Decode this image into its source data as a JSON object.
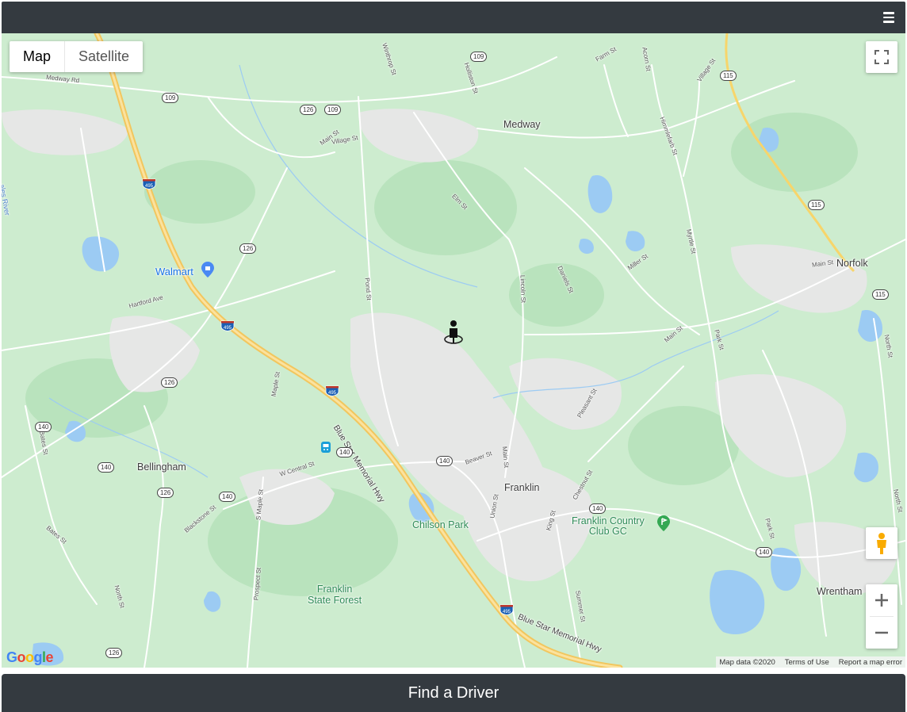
{
  "menu_icon": "hamburger-icon",
  "map": {
    "type_controls": {
      "map": "Map",
      "satellite": "Satellite"
    },
    "towns": {
      "medway": "Medway",
      "norfolk": "Norfolk",
      "bellingham": "Bellingham",
      "franklin": "Franklin",
      "wrentham": "Wrentham"
    },
    "places": {
      "walmart": "Walmart",
      "chilson_park": "Chilson Park",
      "franklin_country_club": "Franklin Country\nClub GC",
      "franklin_state_forest": "Franklin\nState Forest",
      "river": "ales River"
    },
    "streets": {
      "medway_rd": "Medway Rd",
      "winthrop_st": "Winthrop St",
      "holliston_st": "Holliston St",
      "farm_st": "Farm St",
      "acorn_st": "Acorn St",
      "village_st_ne": "Village St",
      "main_st_nw": "Main St",
      "village_st": "Village St",
      "elm_st": "Elm St",
      "himmlefarb_st": "Himmlefarb St",
      "hartford_ave": "Hartford Ave",
      "pond_st": "Pond St",
      "lincoln_st": "Lincoln St",
      "daniels_st": "Daniels St",
      "miller_st": "Miller St",
      "myrtle_st": "Myrtle St",
      "main_st_ne": "Main St",
      "park_st": "Park St",
      "main_st_e": "Main St",
      "north_st_e": "North St",
      "maple_st": "Maple St",
      "blue_star_hwy": "Blue Star Memorial Hwy",
      "blue_star_hwy_2": "Blue Star Memorial Hwy",
      "w_central_st": "W Central St",
      "beaver_st": "Beaver St",
      "main_st_franklin": "Main St",
      "pleasant_st": "Pleasant St",
      "chestnut_st": "Chestnut St",
      "union_st": "Union St",
      "king_st": "King St",
      "bates_st": "Bates St",
      "s_maple_st": "S Maple St",
      "blackstone_st": "Blackstone St",
      "bates_st_2": "Bates St",
      "north_st": "North St",
      "prospect_st": "Prospect St",
      "summer_st": "Summer St",
      "park_st_2": "Park St",
      "north_st_2": "North St"
    },
    "shields": {
      "r109a": "109",
      "r109b": "109",
      "r109c": "109",
      "r126a": "126",
      "r126b": "126",
      "r126c": "126",
      "r126d": "126",
      "r126e": "126",
      "r115a": "115",
      "r115b": "115",
      "r115c": "115",
      "r140a": "140",
      "r140b": "140",
      "r140c": "140",
      "r140d": "140",
      "r140e": "140",
      "r140f": "140",
      "r140g": "140",
      "i495a": "495",
      "i495b": "495",
      "i495c": "495",
      "i495d": "495"
    },
    "controls": {
      "fullscreen_icon": "fullscreen-icon",
      "pegman_icon": "pegman-icon",
      "zoom_in_icon": "plus-icon",
      "zoom_out_icon": "minus-icon"
    },
    "marker_icon": "person-pin-icon",
    "logo": "Google",
    "attribution": {
      "map_data": "Map data ©2020",
      "terms": "Terms of Use",
      "report": "Report a map error"
    }
  },
  "footer": {
    "button_label": "Find a Driver"
  }
}
